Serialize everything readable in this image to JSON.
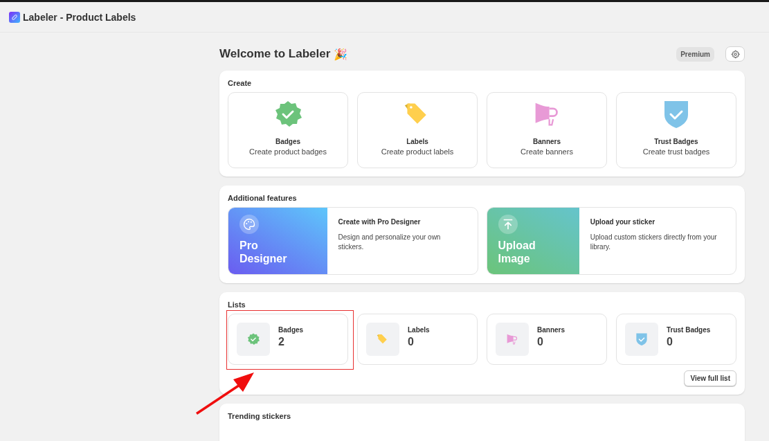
{
  "app": {
    "title": "Labeler - Product Labels"
  },
  "header": {
    "title": "Welcome to Labeler",
    "emoji": "🎉",
    "plan_badge": "Premium"
  },
  "create": {
    "title": "Create",
    "items": [
      {
        "kind": "badge",
        "title": "Badges",
        "subtitle": "Create product badges"
      },
      {
        "kind": "label",
        "title": "Labels",
        "subtitle": "Create product labels"
      },
      {
        "kind": "banner",
        "title": "Banners",
        "subtitle": "Create banners"
      },
      {
        "kind": "trust",
        "title": "Trust Badges",
        "subtitle": "Create trust badges"
      }
    ]
  },
  "features": {
    "title": "Additional features",
    "items": [
      {
        "kind": "designer",
        "banner_text": "Pro Designer",
        "title": "Create with Pro Designer",
        "description": "Design and personalize your own stickers."
      },
      {
        "kind": "upload",
        "banner_text": "Upload Image",
        "title": "Upload your sticker",
        "description": "Upload custom stickers directly from your library."
      }
    ]
  },
  "lists": {
    "title": "Lists",
    "items": [
      {
        "kind": "badge",
        "title": "Badges",
        "count": "2",
        "highlighted": true
      },
      {
        "kind": "label",
        "title": "Labels",
        "count": "0",
        "highlighted": false
      },
      {
        "kind": "banner",
        "title": "Banners",
        "count": "0",
        "highlighted": false
      },
      {
        "kind": "trust",
        "title": "Trust Badges",
        "count": "0",
        "highlighted": false
      }
    ],
    "button": "View full list"
  },
  "trending": {
    "title": "Trending stickers"
  }
}
